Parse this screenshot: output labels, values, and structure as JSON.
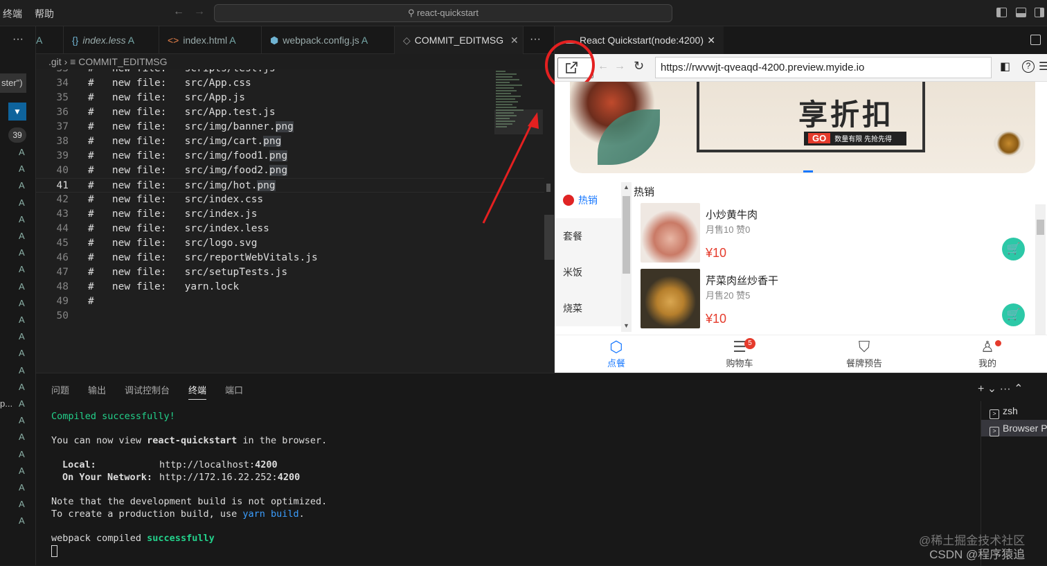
{
  "titlebar": {
    "menu": [
      "终端",
      "帮助"
    ],
    "command_center": "react-quickstart"
  },
  "sidebar": {
    "more": "···",
    "partial_label": "ster\")",
    "badge": "39",
    "status_letter": "A",
    "edge_text": "p..."
  },
  "tabs": [
    {
      "label": "A",
      "icon": ""
    },
    {
      "label": "index.less",
      "status": "A",
      "icon": "{}"
    },
    {
      "label": "index.html",
      "status": "A",
      "icon": "<>"
    },
    {
      "label": "webpack.config.js",
      "status": "A",
      "icon": "⬢"
    },
    {
      "label": "COMMIT_EDITMSG",
      "status": "",
      "icon": "◇",
      "close": "✕"
    }
  ],
  "tabs_more": "···",
  "breadcrumb": {
    "folder": ".git",
    "sep": "›",
    "file": "COMMIT_EDITMSG"
  },
  "editor": {
    "lines": [
      {
        "n": "33",
        "t": "#   new file:   scripts/test.js"
      },
      {
        "n": "34",
        "t": "#   new file:   src/App.css"
      },
      {
        "n": "35",
        "t": "#   new file:   src/App.js"
      },
      {
        "n": "36",
        "t": "#   new file:   src/App.test.js"
      },
      {
        "n": "37",
        "t": "#   new file:   src/img/banner.",
        "h": "png"
      },
      {
        "n": "38",
        "t": "#   new file:   src/img/cart.",
        "h": "png"
      },
      {
        "n": "39",
        "t": "#   new file:   src/img/food1.",
        "h": "png"
      },
      {
        "n": "40",
        "t": "#   new file:   src/img/food2.",
        "h": "png"
      },
      {
        "n": "41",
        "t": "#   new file:   src/img/hot.",
        "h": "png"
      },
      {
        "n": "42",
        "t": "#   new file:   src/index.css"
      },
      {
        "n": "43",
        "t": "#   new file:   src/index.js"
      },
      {
        "n": "44",
        "t": "#   new file:   src/index.less"
      },
      {
        "n": "45",
        "t": "#   new file:   src/logo.svg"
      },
      {
        "n": "46",
        "t": "#   new file:   src/reportWebVitals.js"
      },
      {
        "n": "47",
        "t": "#   new file:   src/setupTests.js"
      },
      {
        "n": "48",
        "t": "#   new file:   yarn.lock"
      },
      {
        "n": "49",
        "t": "#"
      },
      {
        "n": "50",
        "t": ""
      }
    ],
    "current_line": "41"
  },
  "browser": {
    "tab_title": "React Quickstart(node:4200)",
    "tab_close": "✕",
    "url": "https://rwvwjt-qveaqd-4200.preview.myide.io",
    "reload": "C",
    "banner": {
      "headline": "享折扣",
      "cta": "GO",
      "cta_text": "数量有限 先抢先得"
    },
    "categories": [
      "热销",
      "套餐",
      "米饭",
      "烧菜"
    ],
    "section_title": "热销",
    "items": [
      {
        "name": "小炒黄牛肉",
        "meta": "月售10 赞0",
        "price": "¥10"
      },
      {
        "name": "芹菜肉丝炒香干",
        "meta": "月售20 赞5",
        "price": "¥10"
      }
    ],
    "tabbar": [
      {
        "label": "点餐",
        "icon": "cube-icon"
      },
      {
        "label": "购物车",
        "icon": "list-icon",
        "badge": "5"
      },
      {
        "label": "餐牌预告",
        "icon": "shield-icon"
      },
      {
        "label": "我的",
        "icon": "user-icon"
      }
    ]
  },
  "panel": {
    "tabs": [
      "问题",
      "输出",
      "调试控制台",
      "终端",
      "端口"
    ],
    "active_tab": "终端",
    "actions": "+ ⌄  ···  ⌃",
    "terminal": {
      "compiled": "Compiled successfully!",
      "view_pre": "You can now view ",
      "app": "react-quickstart",
      "view_post": " in the browser.",
      "local_label": "Local:",
      "local_url": "http://localhost:",
      "local_port": "4200",
      "network_label": "On Your Network:",
      "network_url": "http://172.16.22.252:",
      "network_port": "4200",
      "note1": "Note that the development build is not optimized.",
      "note2_pre": "To create a production build, use ",
      "note2_cmd": "yarn build",
      "note2_post": ".",
      "webpack_pre": "webpack compiled ",
      "webpack_ok": "successfully"
    },
    "terminals": [
      "zsh",
      "Browser P"
    ]
  },
  "watermark": {
    "line1": "@稀土掘金技术社区",
    "line2": "CSDN @程序猿追"
  }
}
